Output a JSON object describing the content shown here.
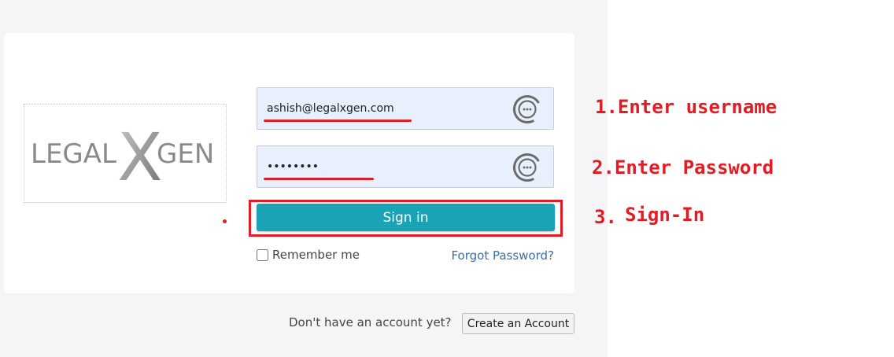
{
  "logo": {
    "part1": "LEGAL",
    "x": "X",
    "part2": "GEN"
  },
  "login": {
    "username_value": "ashish@legalxgen.com",
    "password_value": "••••••••",
    "signin_label": "Sign in",
    "remember_label": "Remember me",
    "forgot_label": "Forgot Password?"
  },
  "footer": {
    "no_account_text": "Don't have an account yet?",
    "create_label": "Create an Account"
  },
  "annotations": {
    "step1": "1.Enter username",
    "step2": "2.Enter Password",
    "step3": "3.",
    "step3_label": "Sign-In"
  },
  "colors": {
    "accent": "#19a4b6",
    "annotation": "#e31b23",
    "field_bg": "#e8f0fe",
    "link": "#3a6ea5"
  },
  "icons": {
    "password_manager": "password-manager-icon"
  }
}
